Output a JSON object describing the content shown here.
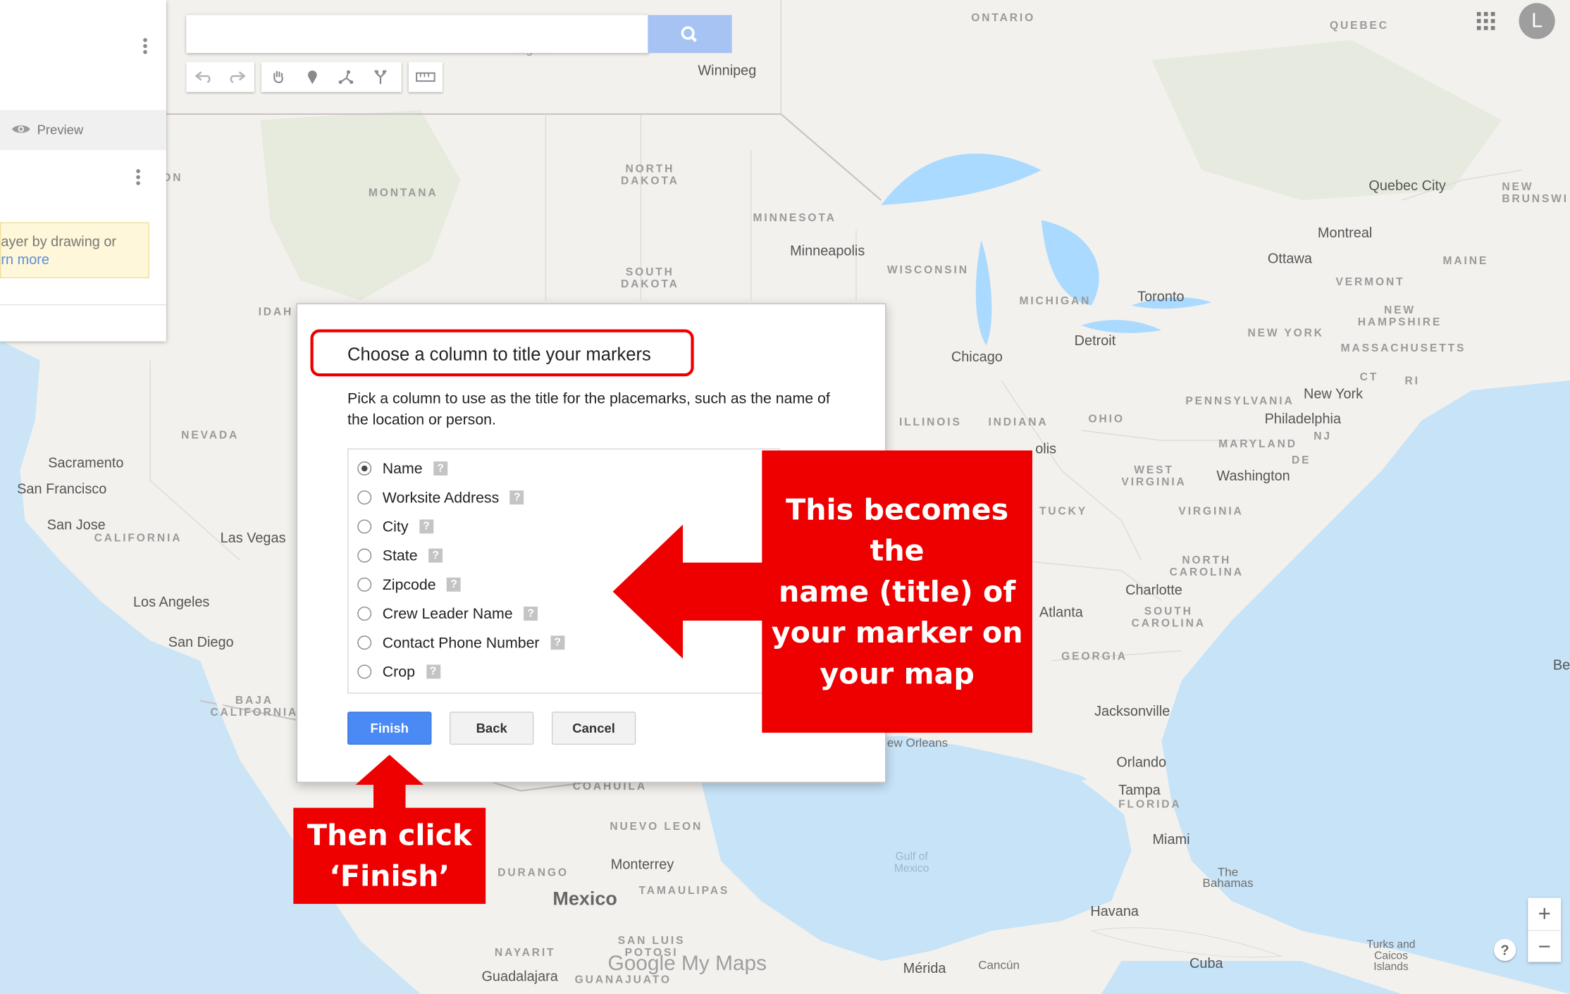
{
  "panel": {
    "preview_label": "Preview",
    "tip_line1": "ayer by drawing or",
    "tip_link": "rn more"
  },
  "account": {
    "avatar_letter": "L"
  },
  "map": {
    "branding": "Google My Maps",
    "labels": {
      "ontario": "ONTARIO",
      "quebec": "QUEBEC",
      "regina": "Regina",
      "winnipeg": "Winnipeg",
      "montana": "MONTANA",
      "north_dakota": "NORTH\nDAKOTA",
      "south_dakota": "SOUTH\nDAKOTA",
      "minnesota": "MINNESOTA",
      "minneapolis": "Minneapolis",
      "wisconsin": "WISCONSIN",
      "michigan": "MICHIGAN",
      "toronto": "Toronto",
      "detroit": "Detroit",
      "chicago": "Chicago",
      "quebec_city": "Quebec City",
      "montreal": "Montreal",
      "ottawa": "Ottawa",
      "maine": "MAINE",
      "vermont": "VERMONT",
      "new_hampshire": "NEW\nHAMPSHIRE",
      "new_york_state": "NEW YORK",
      "massachusetts": "MASSACHUSETTS",
      "ct": "CT",
      "ri": "RI",
      "new_brunswick": "NEW\nBRUNSWI",
      "pennsylvania": "PENNSYLVANIA",
      "new_york": "New York",
      "philadelphia": "Philadelphia",
      "nj": "NJ",
      "maryland": "MARYLAND",
      "de": "DE",
      "washington": "Washington",
      "ohio": "OHIO",
      "indiana": "INDIANA",
      "illinois": "ILLINOIS",
      "west_virginia": "WEST\nVIRGINIA",
      "virginia": "VIRGINIA",
      "kentucky": "TUCKY",
      "north_carolina": "NORTH\nCAROLINA",
      "charlotte": "Charlotte",
      "south_carolina": "SOUTH\nCAROLINA",
      "atlanta": "Atlanta",
      "georgia": "GEORGIA",
      "jacksonville": "Jacksonville",
      "orlando": "Orlando",
      "tampa": "Tampa",
      "florida": "FLORIDA",
      "miami": "Miami",
      "bahamas": "The\nBahamas",
      "havana": "Havana",
      "cuba": "Cuba",
      "turks": "Turks and\nCaicos\nIslands",
      "nevada": "NEVADA",
      "sacramento": "Sacramento",
      "san_francisco": "San Francisco",
      "san_jose": "San Jose",
      "california": "CALIFORNIA",
      "las_vegas": "Las Vegas",
      "los_angeles": "Los Angeles",
      "san_diego": "San Diego",
      "baja": "BAJA\nCALIFORNIA",
      "idaho": "IDAH",
      "coahuila": "COAHUILA",
      "nuevo_leon": "NUEVO LEON",
      "monterrey": "Monterrey",
      "durango": "DURANGO",
      "tamaulipas": "TAMAULIPAS",
      "mexico": "Mexico",
      "san_luis": "SAN LUIS\nPOTOSI",
      "nayarit": "NAYARIT",
      "guadalajara": "Guadalajara",
      "guanajuato": "GUANAJUATO",
      "gulf": "Gulf of\nMexico",
      "merida": "Mérida",
      "cancun": "Cancún",
      "new_orleans": "ew Orleans",
      "indianapolis_tail": "olis",
      "be": "Be",
      "on_partial": "ON"
    }
  },
  "dialog": {
    "title": "Choose a column to title your markers",
    "description": "Pick a column to use as the title for the placemarks, such as the name of the location or person.",
    "options": [
      {
        "label": "Name",
        "selected": true
      },
      {
        "label": "Worksite Address",
        "selected": false
      },
      {
        "label": "City",
        "selected": false
      },
      {
        "label": "State",
        "selected": false
      },
      {
        "label": "Zipcode",
        "selected": false
      },
      {
        "label": "Crew Leader Name",
        "selected": false
      },
      {
        "label": "Contact Phone Number",
        "selected": false
      },
      {
        "label": "Crop",
        "selected": false
      }
    ],
    "help_glyph": "?",
    "finish_label": "Finish",
    "back_label": "Back",
    "cancel_label": "Cancel"
  },
  "annotations": {
    "right_callout": [
      "This becomes the",
      "name (title) of",
      "your marker on",
      "your map"
    ],
    "bottom_callout": [
      "Then click",
      "‘Finish’"
    ],
    "accent_color": "#ee0000"
  },
  "map_controls": {
    "zoom_in": "+",
    "zoom_out": "−",
    "help": "?"
  }
}
